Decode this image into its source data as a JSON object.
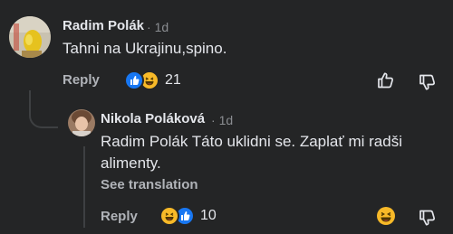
{
  "comment": {
    "author": "Radim Polák",
    "separator": "·",
    "time": "1d",
    "text": "Tahni na Ukrajinu,spino.",
    "reply_label": "Reply",
    "reaction_count": "21",
    "reactions": [
      "like-icon",
      "haha-icon"
    ],
    "actions": [
      "thumbs-up-icon",
      "thumbs-down-icon"
    ]
  },
  "reply": {
    "author": "Nikola Poláková",
    "separator": "·",
    "time": "1d",
    "text": "Radim Polák Táto uklidni se. Zaplať mi radši aliment­y.",
    "text_line1": "Radim Polák Táto uklidni se. Zaplať mi radši",
    "text_line2": "alimenty.",
    "see_translation": "See translation",
    "reply_label": "Reply",
    "reaction_count": "10",
    "reactions": [
      "haha-icon",
      "like-icon"
    ],
    "actions": [
      "haha-react-icon",
      "thumbs-down-icon"
    ]
  },
  "colors": {
    "background": "#242526",
    "text": "#e4e6eb",
    "secondary": "#b0b3b8",
    "like_blue": "#1877f2",
    "haha_yellow": "#f7b928"
  }
}
